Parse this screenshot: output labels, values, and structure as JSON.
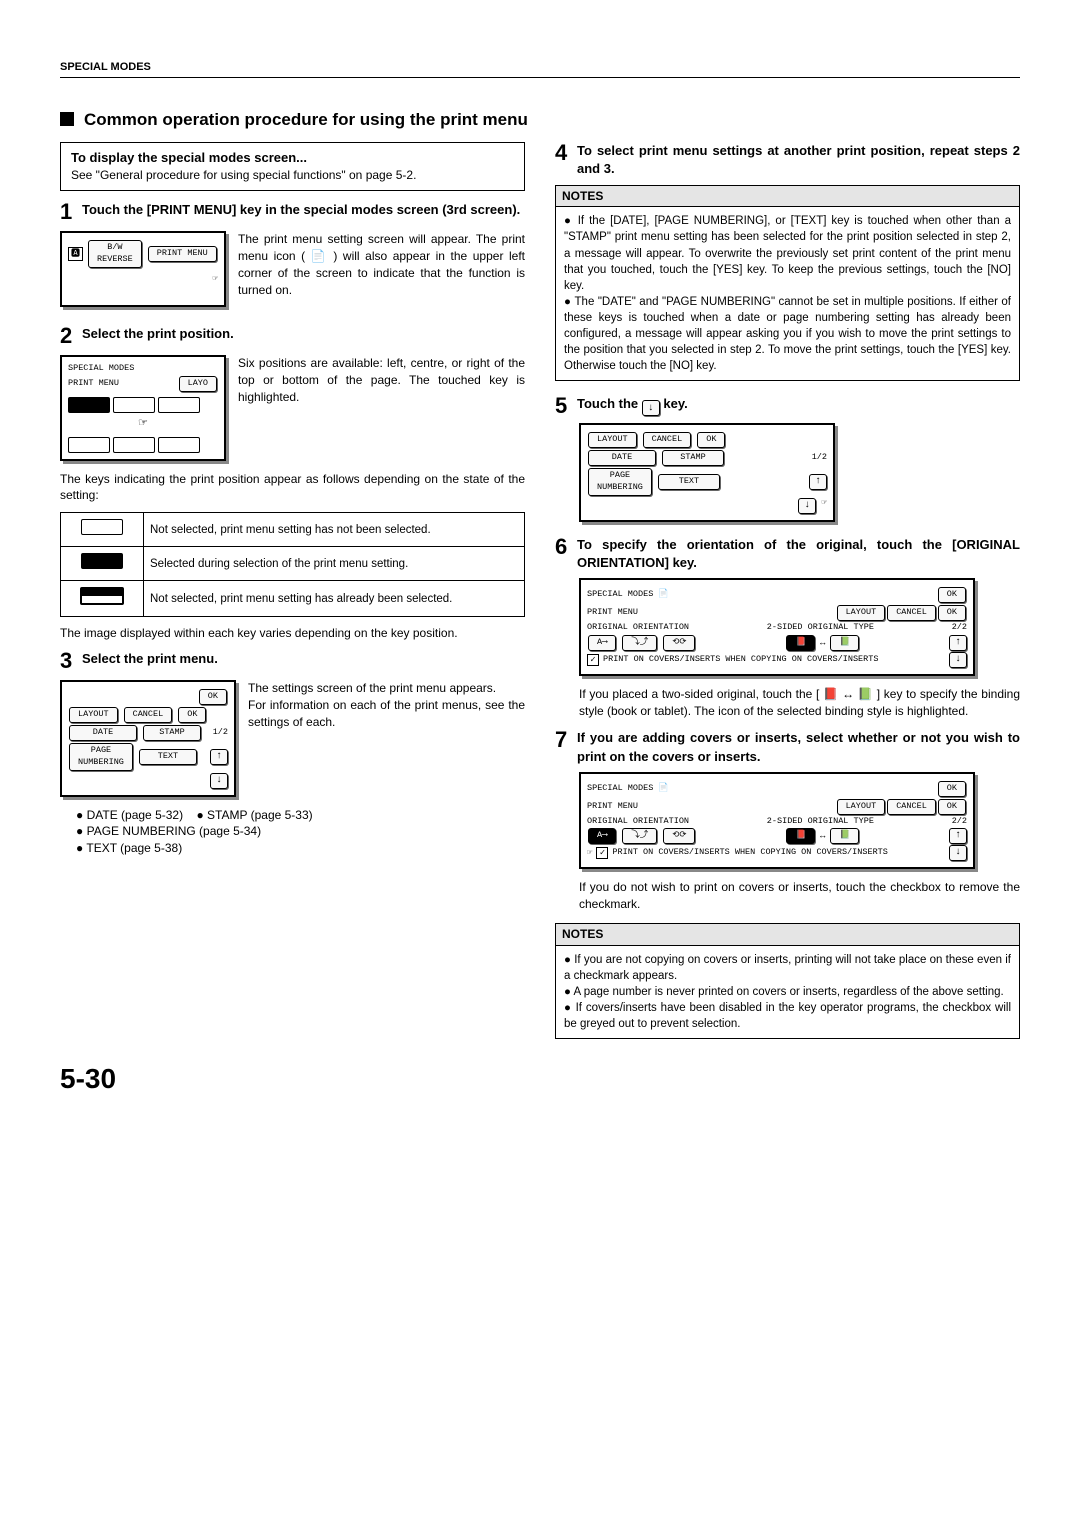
{
  "header": {
    "label": "SPECIAL MODES"
  },
  "section": {
    "title": "Common operation procedure for using the print menu"
  },
  "intro_box": {
    "title": "To display the special modes screen...",
    "body": "See \"General procedure for using special functions\" on page 5-2."
  },
  "steps_left": {
    "s1": {
      "num": "1",
      "title": "Touch the [PRINT MENU] key in the special modes screen (3rd screen).",
      "fig": {
        "bw": "B/W\nREVERSE",
        "pm": "PRINT MENU"
      },
      "para": "The print menu setting screen will appear. The print menu icon ( 📄 ) will also appear in the upper left corner of the screen to indicate that the function is turned on."
    },
    "s2": {
      "num": "2",
      "title": "Select the print position.",
      "fig": {
        "top": "SPECIAL MODES",
        "row": "PRINT MENU",
        "layo": "LAYO"
      },
      "para": "Six positions are available: left, centre, or right of the top or bottom of the page. The touched key is highlighted.",
      "after": "The keys indicating the print position appear as follows depending on the state of the setting:",
      "legend": {
        "r1": "Not selected, print menu setting has not been selected.",
        "r2": "Selected during selection of the print menu setting.",
        "r3": "Not selected, print menu setting has already been selected."
      },
      "after2": "The image displayed within each key varies depending on the key position."
    },
    "s3": {
      "num": "3",
      "title": "Select the print menu.",
      "fig": {
        "ok": "OK",
        "layout": "LAYOUT",
        "cancel": "CANCEL",
        "date": "DATE",
        "stamp": "STAMP",
        "pnum": "PAGE\nNUMBERING",
        "text": "TEXT",
        "frac": "1/2"
      },
      "para": "The settings screen of the print menu appears.\nFor information on each of the print menus, see the settings of each.",
      "bullets": {
        "b1": "DATE (page 5-32)",
        "b2": "STAMP (page 5-33)",
        "b3": "PAGE NUMBERING (page 5-34)",
        "b4": "TEXT (page 5-38)"
      }
    }
  },
  "steps_right": {
    "s4": {
      "num": "4",
      "title": "To select print menu settings at another print position, repeat steps 2 and 3."
    },
    "notes1": {
      "head": "NOTES",
      "n1": "If the [DATE], [PAGE NUMBERING], or [TEXT] key is touched when other than a \"STAMP\" print menu setting has been selected for the print position selected in step 2, a message will appear. To overwrite the previously set print content of the print menu that you touched, touch the [YES] key. To keep the previous settings, touch the [NO] key.",
      "n2": "The \"DATE\" and \"PAGE NUMBERING\" cannot be set in multiple positions. If either of these keys is touched when a date or page numbering setting has already been configured, a message will appear asking you if you wish to move the print settings to the position that you selected in step 2. To move the print settings, touch the [YES] key. Otherwise touch the [NO] key."
    },
    "s5": {
      "num": "5",
      "title_prefix": "Touch the ",
      "title_suffix": " key.",
      "fig": {
        "layout": "LAYOUT",
        "cancel": "CANCEL",
        "ok": "OK",
        "date": "DATE",
        "stamp": "STAMP",
        "pnum": "PAGE\nNUMBERING",
        "text": "TEXT",
        "frac": "1/2"
      }
    },
    "s6": {
      "num": "6",
      "title": "To specify the orientation of the original, touch the [ORIGINAL ORIENTATION] key.",
      "fig": {
        "sm": "SPECIAL MODES",
        "ok1": "OK",
        "pm": "PRINT MENU",
        "layout": "LAYOUT",
        "cancel": "CANCEL",
        "ok2": "OK",
        "oo": "ORIGINAL ORIENTATION",
        "sot": "2-SIDED ORIGINAL TYPE",
        "frac": "2/2",
        "foot": "PRINT ON COVERS/INSERTS WHEN COPYING ON COVERS/INSERTS"
      },
      "para": "If you placed a two-sided original, touch the [ 📕 ↔ 📗 ] key to specify the binding style (book or tablet). The icon of the selected binding style is highlighted."
    },
    "s7": {
      "num": "7",
      "title": "If you are adding covers or inserts, select whether or not you wish to print on the covers or inserts.",
      "fig": {
        "sm": "SPECIAL MODES",
        "ok1": "OK",
        "pm": "PRINT MENU",
        "layout": "LAYOUT",
        "cancel": "CANCEL",
        "ok2": "OK",
        "oo": "ORIGINAL ORIENTATION",
        "sot": "2-SIDED ORIGINAL TYPE",
        "frac": "2/2",
        "foot": "PRINT ON COVERS/INSERTS WHEN COPYING ON COVERS/INSERTS"
      },
      "para": "If you do not wish to print on covers or inserts, touch the checkbox to remove the checkmark."
    },
    "notes2": {
      "head": "NOTES",
      "n1": "If you are not copying on covers or inserts, printing will not take place on these even if a checkmark appears.",
      "n2": "A page number is never printed on covers or inserts, regardless of the above setting.",
      "n3": "If covers/inserts have been disabled in the key operator programs, the checkbox will be greyed out to prevent selection."
    }
  },
  "page_number": "5-30"
}
